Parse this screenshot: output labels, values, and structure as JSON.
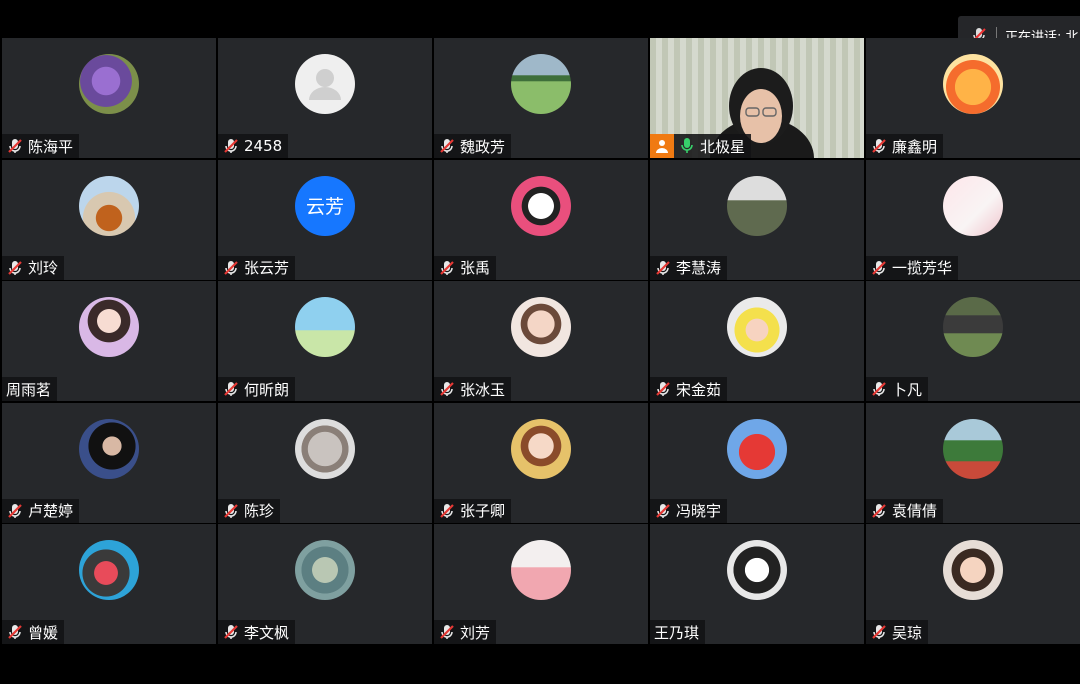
{
  "speaking_bar": {
    "label": "正在讲话: 北"
  },
  "participants": [
    {
      "name": "陈海平",
      "mic": "muted",
      "avatar": "purple-flower"
    },
    {
      "name": "2458",
      "mic": "muted",
      "avatar": "default-person"
    },
    {
      "name": "魏政芳",
      "mic": "muted",
      "avatar": "grass-field"
    },
    {
      "name": "北极星",
      "mic": "active",
      "avatar": "camera-video"
    },
    {
      "name": "廉鑫明",
      "mic": "muted",
      "avatar": "cartoon-face"
    },
    {
      "name": "刘玲",
      "mic": "muted",
      "avatar": "peace-sign"
    },
    {
      "name": "张云芳",
      "mic": "muted",
      "avatar_text": "云芳"
    },
    {
      "name": "张禹",
      "mic": "muted",
      "avatar": "cartoon-girl"
    },
    {
      "name": "李慧涛",
      "mic": "muted",
      "avatar": "person-photo"
    },
    {
      "name": "一揽芳华",
      "mic": "muted",
      "avatar": "pink-pattern"
    },
    {
      "name": "周雨茗",
      "mic": "none",
      "avatar": "anime-girl"
    },
    {
      "name": "何昕朗",
      "mic": "muted",
      "avatar": "dancer-sky"
    },
    {
      "name": "张冰玉",
      "mic": "muted",
      "avatar": "girl-portrait"
    },
    {
      "name": "宋金茹",
      "mic": "muted",
      "avatar": "yellow-hat"
    },
    {
      "name": "卜凡",
      "mic": "muted",
      "avatar": "outdoor-legs"
    },
    {
      "name": "卢楚婷",
      "mic": "muted",
      "avatar": "woman-dark"
    },
    {
      "name": "陈珍",
      "mic": "muted",
      "avatar": "cat"
    },
    {
      "name": "张子卿",
      "mic": "muted",
      "avatar": "smiling-girl"
    },
    {
      "name": "冯晓宇",
      "mic": "muted",
      "avatar": "red-teletubby"
    },
    {
      "name": "袁倩倩",
      "mic": "muted",
      "avatar": "garden"
    },
    {
      "name": "曾媛",
      "mic": "muted",
      "avatar": "sheep-cartoon"
    },
    {
      "name": "李文枫",
      "mic": "muted",
      "avatar": "teal-abstract"
    },
    {
      "name": "刘芳",
      "mic": "muted",
      "avatar": "pink-coat"
    },
    {
      "name": "王乃琪",
      "mic": "none",
      "avatar": "kuromi"
    },
    {
      "name": "吴琼",
      "mic": "muted",
      "avatar": "laughing-girl"
    }
  ],
  "colors": {
    "tile_bg": "#26282b",
    "speaking_border": "#2db86a",
    "avatar_text_bg": "#1677ff",
    "camera_button": "#f07a12",
    "active_mic": "#37d16b"
  }
}
